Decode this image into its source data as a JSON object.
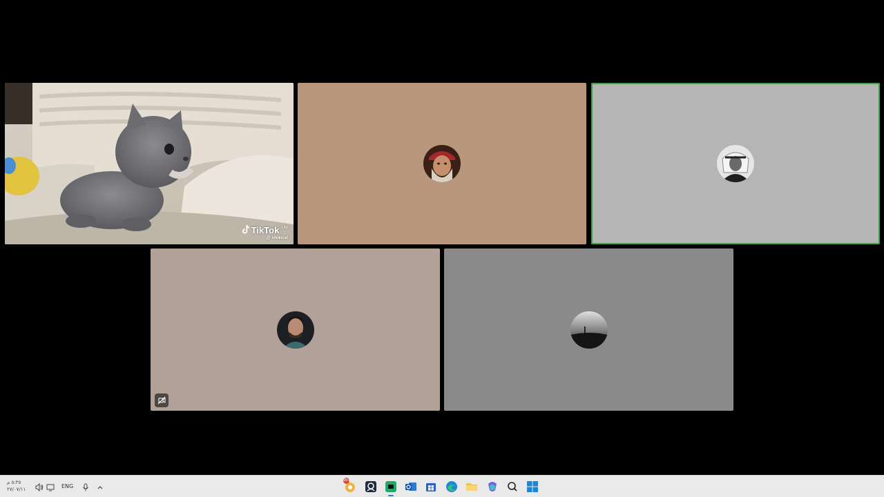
{
  "meeting": {
    "participants": [
      {
        "id": "p1",
        "kind": "video",
        "speaking": true,
        "watermark": {
          "brand": "TikTok",
          "sup": "Lite",
          "user": "@ xikikicat"
        }
      },
      {
        "id": "p2",
        "kind": "avatar",
        "speaking": false,
        "background": "#b9977a"
      },
      {
        "id": "p3",
        "kind": "avatar",
        "speaking": true,
        "background": "#b5b5b5"
      },
      {
        "id": "p4",
        "kind": "avatar",
        "speaking": false,
        "background": "#b2a198",
        "muted": true
      },
      {
        "id": "p5",
        "kind": "avatar",
        "speaking": false,
        "background": "#8a8a8a"
      }
    ],
    "speaking_outline_color": "#4c9a4c"
  },
  "taskbar": {
    "clock_time": "٥:٣٥ م",
    "clock_date": "٢٧/٠٧/١١",
    "language": "ENG",
    "tray_icons": [
      "volume-icon",
      "network-icon",
      "microphone-icon",
      "chevron-up-icon"
    ],
    "apps": [
      "notifications-app",
      "contacts-app",
      "teams-app",
      "outlook-app",
      "store-app",
      "edge-app",
      "file-explorer-app",
      "copilot-app",
      "search-app",
      "start-app"
    ],
    "badge_count": "99+"
  }
}
